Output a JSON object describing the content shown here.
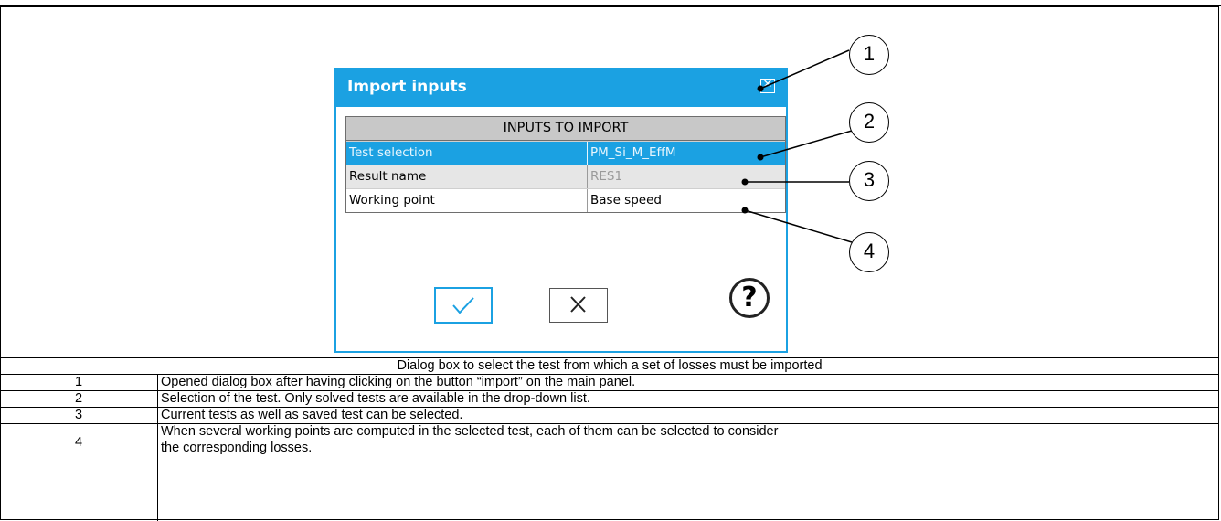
{
  "dialog": {
    "title": "Import inputs",
    "close_icon": "close-box-icon",
    "table": {
      "header": "INPUTS TO IMPORT",
      "rows": [
        {
          "label": "Test selection",
          "value": "PM_Si_M_EffM"
        },
        {
          "label": "Result name",
          "value": "RES1"
        },
        {
          "label": "Working point",
          "value": "Base speed"
        }
      ]
    },
    "ok_icon": "checkmark-icon",
    "cancel_icon": "cross-icon",
    "help_glyph": "?",
    "help_icon": "help-circle-icon"
  },
  "callouts": [
    "1",
    "2",
    "3",
    "4"
  ],
  "caption": {
    "title": "Dialog box to select the test from which a set of losses must be imported",
    "items": [
      {
        "num": "1",
        "text": "Opened dialog box after having clicking on the button “import” on the main panel."
      },
      {
        "num": "2",
        "text": "Selection of the test. Only solved tests are available in the drop-down list."
      },
      {
        "num": "3",
        "text": "Current tests as well as saved test can be selected."
      },
      {
        "num": "4",
        "text_line1": "When several working points are computed in the selected test, each of them can be selected to consider",
        "text_line2": "the corresponding losses."
      }
    ]
  },
  "colors": {
    "accent": "#1ba1e2",
    "header_gray": "#c8c8c8",
    "row_gray": "#e6e6e6"
  }
}
